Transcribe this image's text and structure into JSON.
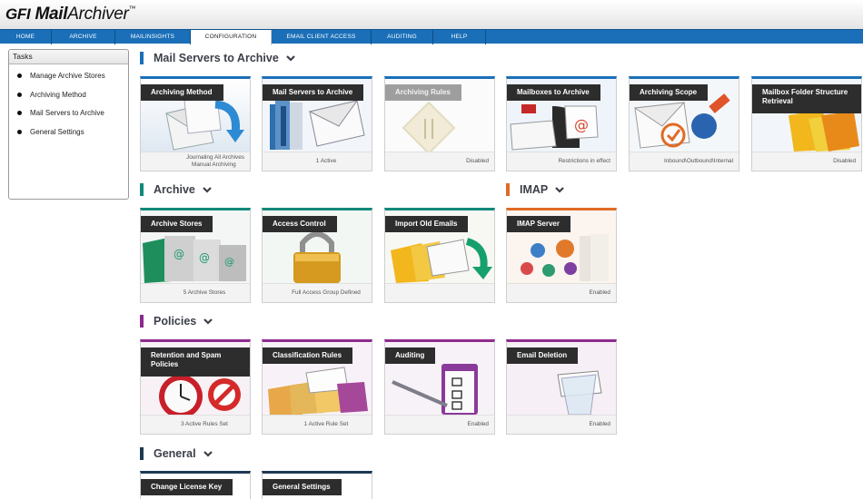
{
  "app": {
    "vendor": "GFI",
    "product_part1": "Mail",
    "product_part2": "Archiver",
    "tm": "™"
  },
  "nav": [
    "Home",
    "Archive",
    "MailInsights",
    "Configuration",
    "Email Client Access",
    "Auditing",
    "Help"
  ],
  "nav_active": "Configuration",
  "tasks": {
    "title": "Tasks",
    "items": [
      "Manage Archive Stores",
      "Archiving Method",
      "Mail Servers to Archive",
      "General Settings"
    ]
  },
  "sections": {
    "mail_servers": {
      "title": "Mail Servers to Archive",
      "color": "#1a6fb8"
    },
    "archive": {
      "title": "Archive",
      "color": "#11897a"
    },
    "imap": {
      "title": "IMAP",
      "color": "#e06b24"
    },
    "policies": {
      "title": "Policies",
      "color": "#8d2a8f"
    },
    "general": {
      "title": "General",
      "color": "#1d3a52"
    }
  },
  "tiles": {
    "archiving_method": {
      "label": "Archiving Method",
      "status1": "Journaling All Archives",
      "status2": "Manual Archiving"
    },
    "mail_servers": {
      "label": "Mail Servers to Archive",
      "status": "1 Active"
    },
    "archiving_rules": {
      "label": "Archiving Rules",
      "status": "Disabled"
    },
    "mailboxes": {
      "label": "Mailboxes to Archive",
      "status": "Restrictions in effect"
    },
    "archiving_scope": {
      "label": "Archiving Scope",
      "status": "Inbound\\Outbound\\Internal"
    },
    "mailbox_folder": {
      "label": "Mailbox Folder Structure Retrieval",
      "status": "Disabled"
    },
    "archive_stores": {
      "label": "Archive Stores",
      "status": "5 Archive Stores"
    },
    "access_control": {
      "label": "Access Control",
      "status": "Full Access Group Defined"
    },
    "import_old": {
      "label": "Import Old Emails",
      "status": ""
    },
    "imap_server": {
      "label": "IMAP Server",
      "status": "Enabled"
    },
    "retention": {
      "label": "Retention and Spam Policies",
      "status": "3 Active Rules Set"
    },
    "classification": {
      "label": "Classification Rules",
      "status": "1 Active Rule Set"
    },
    "auditing": {
      "label": "Auditing",
      "status": "Enabled"
    },
    "email_deletion": {
      "label": "Email Deletion",
      "status": "Enabled"
    },
    "license": {
      "label": "Change License Key"
    },
    "general_settings": {
      "label": "General Settings"
    }
  }
}
